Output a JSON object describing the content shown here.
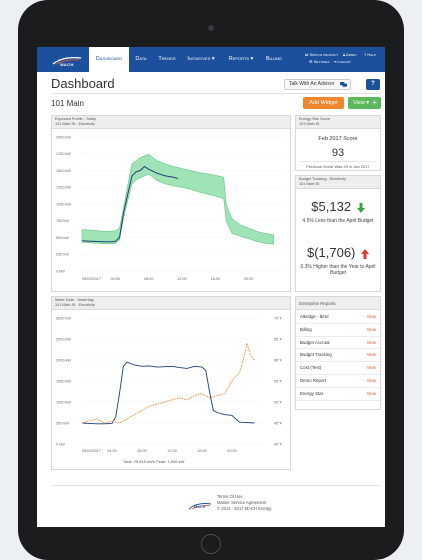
{
  "brand": {
    "logo_text": "MACH",
    "accent": "#1c4f9c",
    "orange": "#f0862d",
    "green": "#5cb85c",
    "band_green": "#7fd99e",
    "line_navy": "#1e3f7a",
    "red": "#e23b2b"
  },
  "nav": {
    "tabs": [
      {
        "label": "Dashboard",
        "active": true
      },
      {
        "label": "Data"
      },
      {
        "label": "Trends"
      },
      {
        "label": "Initiatives ▾"
      },
      {
        "label": "Reports ▾"
      },
      {
        "label": "Billing"
      }
    ],
    "utility": {
      "switch_product": "Switch product",
      "admin": "Admin",
      "help": "Help",
      "settings": "Settings",
      "logout": "Logout"
    }
  },
  "header": {
    "title": "Dashboard",
    "advisor_button": "Talk With An Advisor",
    "help_button": "?"
  },
  "site": {
    "name": "101 Main",
    "add_widget": "Add Widget",
    "view": "View ▾",
    "plus": "+"
  },
  "expected_profile": {
    "title": "Expected Profile - Today",
    "subtitle": "101 Main St - Electricity",
    "chart_data": {
      "type": "line",
      "y_ticks": [
        "2000 kW",
        "1750 kW",
        "1500 kW",
        "1250 kW",
        "1000 kW",
        "750 kW",
        "500 kW",
        "250 kW",
        "0 kW"
      ],
      "x_ticks": [
        "05/03/2017",
        "04:00",
        "08:00",
        "12:00",
        "16:00",
        "20:00"
      ],
      "ylim": [
        0,
        2000
      ],
      "x_hours": [
        0,
        1,
        2,
        3,
        4,
        4.5,
        5,
        5.5,
        6,
        6.5,
        7,
        7.5,
        8,
        9,
        10,
        11,
        12,
        13,
        14,
        15,
        16,
        17,
        17.3,
        18,
        19,
        20,
        21,
        22,
        23
      ],
      "band_low": [
        430,
        420,
        410,
        405,
        410,
        460,
        800,
        1050,
        1300,
        1360,
        1390,
        1420,
        1450,
        1350,
        1300,
        1270,
        1250,
        1220,
        1180,
        1150,
        1120,
        1080,
        750,
        560,
        520,
        480,
        440,
        410,
        400
      ],
      "band_high": [
        620,
        610,
        600,
        590,
        600,
        640,
        950,
        1280,
        1600,
        1650,
        1690,
        1720,
        1740,
        1650,
        1600,
        1560,
        1530,
        1500,
        1470,
        1450,
        1430,
        1400,
        1000,
        780,
        690,
        640,
        590,
        560,
        540
      ],
      "series": [
        {
          "name": "",
          "x_hours": [
            0,
            1,
            2,
            3,
            4,
            4.5,
            5,
            5.5,
            6,
            6.5,
            7,
            7.5,
            8,
            9,
            10,
            11,
            11.5
          ],
          "values": [
            450,
            445,
            440,
            435,
            440,
            500,
            880,
            1150,
            1420,
            1480,
            1500,
            1560,
            1520,
            1460,
            1420,
            1400,
            1380
          ]
        }
      ]
    }
  },
  "energy_star": {
    "title": "Energy Star Score",
    "subtitle": "101 Main St",
    "score_title": "Feb 2017 Score",
    "score": "93",
    "previous": "Previous Score Was 93 in Jan 2017"
  },
  "budget": {
    "title": "Budget Tracking - Electricity",
    "subtitle": "101 Main St",
    "amount1": "$5,132",
    "desc1": "4.5% Less than the April Budget",
    "amount2": "$(1,706)",
    "desc2": "0.3% Higher than the Year to April Budget"
  },
  "meter_data": {
    "title": "Meter Data - Yesterday",
    "subtitle": "101 Main St - Electricity",
    "legend": "Total: 29,815 kWh   Peak: 1,946 kW",
    "chart_data": {
      "type": "line",
      "y_ticks": [
        "3000 kW",
        "2500 kW",
        "2000 kW",
        "1500 kW",
        "1000 kW",
        "500 kW",
        "0 kW"
      ],
      "y2_ticks": [
        "70°F",
        "65°F",
        "60°F",
        "55°F",
        "50°F",
        "45°F",
        "40°F"
      ],
      "x_ticks": [
        "05/02/2017",
        "04:00",
        "08:00",
        "12:00",
        "16:00",
        "20:00"
      ],
      "ylim": [
        0,
        3000
      ],
      "y2lim": [
        40,
        70
      ],
      "series": [
        {
          "name": "",
          "axis": "left",
          "x_hours": [
            0,
            1,
            2,
            3,
            4,
            4.5,
            5,
            5.5,
            6,
            7,
            8,
            9,
            10,
            11,
            12,
            13,
            14,
            15,
            16,
            16.5,
            17,
            17.5,
            18,
            19,
            20,
            21,
            22,
            23
          ],
          "values": [
            500,
            490,
            480,
            480,
            490,
            650,
            1200,
            1850,
            1950,
            1880,
            1850,
            1860,
            1830,
            1840,
            1850,
            1820,
            1800,
            1850,
            1830,
            1750,
            1250,
            800,
            750,
            700,
            680,
            520,
            510,
            500
          ]
        },
        {
          "name": "",
          "axis": "right",
          "x_hours": [
            0,
            1,
            2,
            3,
            4,
            5,
            6,
            7,
            8,
            9,
            10,
            11,
            12,
            13,
            14,
            15,
            16,
            17,
            18,
            19,
            20,
            21,
            21.5,
            22,
            22.5,
            23
          ],
          "values": [
            45,
            45.5,
            46,
            45,
            45.5,
            45,
            46,
            47,
            48,
            49,
            49.5,
            50,
            50.5,
            51,
            50.5,
            51.5,
            52,
            51,
            51.5,
            52,
            55,
            57,
            60,
            64,
            61,
            60
          ]
        }
      ]
    }
  },
  "reports": {
    "title": "Enterprise Reports",
    "items": [
      {
        "label": "Alkridge - $/ref",
        "action": "View"
      },
      {
        "label": "Billing",
        "action": "View"
      },
      {
        "label": "Budget Accrual",
        "action": "View"
      },
      {
        "label": "Budget Tracking",
        "action": "View"
      },
      {
        "label": "Cost (Test)",
        "action": "View"
      },
      {
        "label": "Demo Report",
        "action": "View"
      },
      {
        "label": "Energy Star",
        "action": "View"
      }
    ]
  },
  "footer": {
    "terms": "Terms Of Use",
    "msa": "Master Service Agreement",
    "copyright": "© 2012 - 2017 MACH Energy",
    "logo_text": "MACH"
  }
}
